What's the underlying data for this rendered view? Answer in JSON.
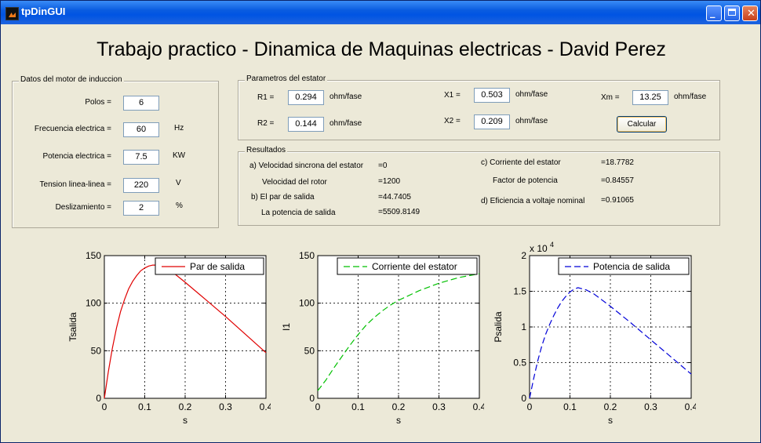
{
  "window": {
    "title": "tpDinGUI"
  },
  "heading": "Trabajo practico - Dinamica de Maquinas electricas - David Perez",
  "motor": {
    "title": "Datos del motor de induccion",
    "fields": [
      {
        "label": "Polos =",
        "value": "6",
        "unit": ""
      },
      {
        "label": "Frecuencia electrica =",
        "value": "60",
        "unit": "Hz"
      },
      {
        "label": "Potencia electrica =",
        "value": "7.5",
        "unit": "KW"
      },
      {
        "label": "Tension linea-linea =",
        "value": "220",
        "unit": "V"
      },
      {
        "label": "Deslizamiento =",
        "value": "2",
        "unit": "%"
      }
    ]
  },
  "estator": {
    "title": "Parametros del estator",
    "r1": {
      "label": "R1 =",
      "value": "0.294",
      "unit": "ohm/fase"
    },
    "r2": {
      "label": "R2 =",
      "value": "0.144",
      "unit": "ohm/fase"
    },
    "x1": {
      "label": "X1 =",
      "value": "0.503",
      "unit": "ohm/fase"
    },
    "x2": {
      "label": "X2 =",
      "value": "0.209",
      "unit": "ohm/fase"
    },
    "xm": {
      "label": "Xm =",
      "value": "13.25",
      "unit": "ohm/fase"
    },
    "calc_label": "Calcular"
  },
  "resultados": {
    "title": "Resultados",
    "vel_sinc_label": "a) Velocidad sincrona del estator",
    "vel_sinc_value": "=0",
    "vel_rotor_label": "Velocidad del rotor",
    "vel_rotor_value": "=1200",
    "par_label": "b) El par de salida",
    "par_value": "=44.7405",
    "pot_label": "La potencia de salida",
    "pot_value": "=5509.8149",
    "corr_label": "c) Corriente del estator",
    "corr_value": "=18.7782",
    "fp_label": "Factor de potencia",
    "fp_value": "=0.84557",
    "efic_label": "d) Eficiencia a voltaje nominal",
    "efic_value": "=0.91065"
  },
  "chart_data": [
    {
      "type": "line",
      "xlabel": "s",
      "ylabel": "Tsalida",
      "xlim": [
        0,
        0.4
      ],
      "ylim": [
        0,
        150
      ],
      "xticks": [
        "0",
        "0.1",
        "0.2",
        "0.3",
        "0.4"
      ],
      "yticks": [
        "0",
        "50",
        "100",
        "150"
      ],
      "grid": true,
      "legend_position": "top-right",
      "series": [
        {
          "name": "Par de salida",
          "color": "#e00000",
          "dash": "solid",
          "x": [
            0,
            0.01,
            0.02,
            0.03,
            0.04,
            0.05,
            0.06,
            0.07,
            0.08,
            0.09,
            0.1,
            0.11,
            0.12,
            0.13,
            0.15,
            0.2,
            0.25,
            0.3,
            0.35,
            0.4
          ],
          "y": [
            0,
            28,
            53,
            74,
            91,
            104,
            115,
            123,
            129,
            134,
            137,
            139,
            140,
            140,
            139,
            122,
            104,
            86,
            67,
            48
          ]
        }
      ]
    },
    {
      "type": "line",
      "xlabel": "s",
      "ylabel": "I1",
      "xlim": [
        0,
        0.4
      ],
      "ylim": [
        0,
        150
      ],
      "xticks": [
        "0",
        "0.1",
        "0.2",
        "0.3",
        "0.4"
      ],
      "yticks": [
        "0",
        "50",
        "100",
        "150"
      ],
      "grid": true,
      "legend_position": "top-right",
      "series": [
        {
          "name": "Corriente del estator",
          "color": "#00c000",
          "dash": "dashed",
          "x": [
            0,
            0.02,
            0.04,
            0.06,
            0.08,
            0.1,
            0.12,
            0.14,
            0.16,
            0.18,
            0.2,
            0.22,
            0.25,
            0.3,
            0.35,
            0.4
          ],
          "y": [
            8,
            19,
            32,
            44,
            56,
            67,
            77,
            85,
            92,
            98,
            103,
            107,
            113,
            121,
            127,
            131
          ]
        }
      ]
    },
    {
      "type": "line",
      "xlabel": "s",
      "ylabel": "Psalida",
      "xlim": [
        0,
        0.4
      ],
      "ylim": [
        0,
        2
      ],
      "xticks": [
        "0",
        "0.1",
        "0.2",
        "0.3",
        "0.4"
      ],
      "yticks": [
        "0",
        "0.5",
        "1",
        "1.5",
        "2"
      ],
      "exponent_label": "x 10",
      "exponent": "4",
      "grid": true,
      "legend_position": "top-right",
      "series": [
        {
          "name": "Potencia de salida",
          "color": "#0000d8",
          "dash": "dashed",
          "x": [
            0,
            0.01,
            0.02,
            0.03,
            0.04,
            0.05,
            0.06,
            0.07,
            0.08,
            0.09,
            0.1,
            0.11,
            0.12,
            0.14,
            0.16,
            0.2,
            0.25,
            0.3,
            0.35,
            0.4
          ],
          "y": [
            0,
            0.27,
            0.52,
            0.73,
            0.9,
            1.04,
            1.16,
            1.27,
            1.36,
            1.43,
            1.49,
            1.53,
            1.55,
            1.52,
            1.46,
            1.29,
            1.06,
            0.82,
            0.58,
            0.34
          ]
        }
      ]
    }
  ]
}
